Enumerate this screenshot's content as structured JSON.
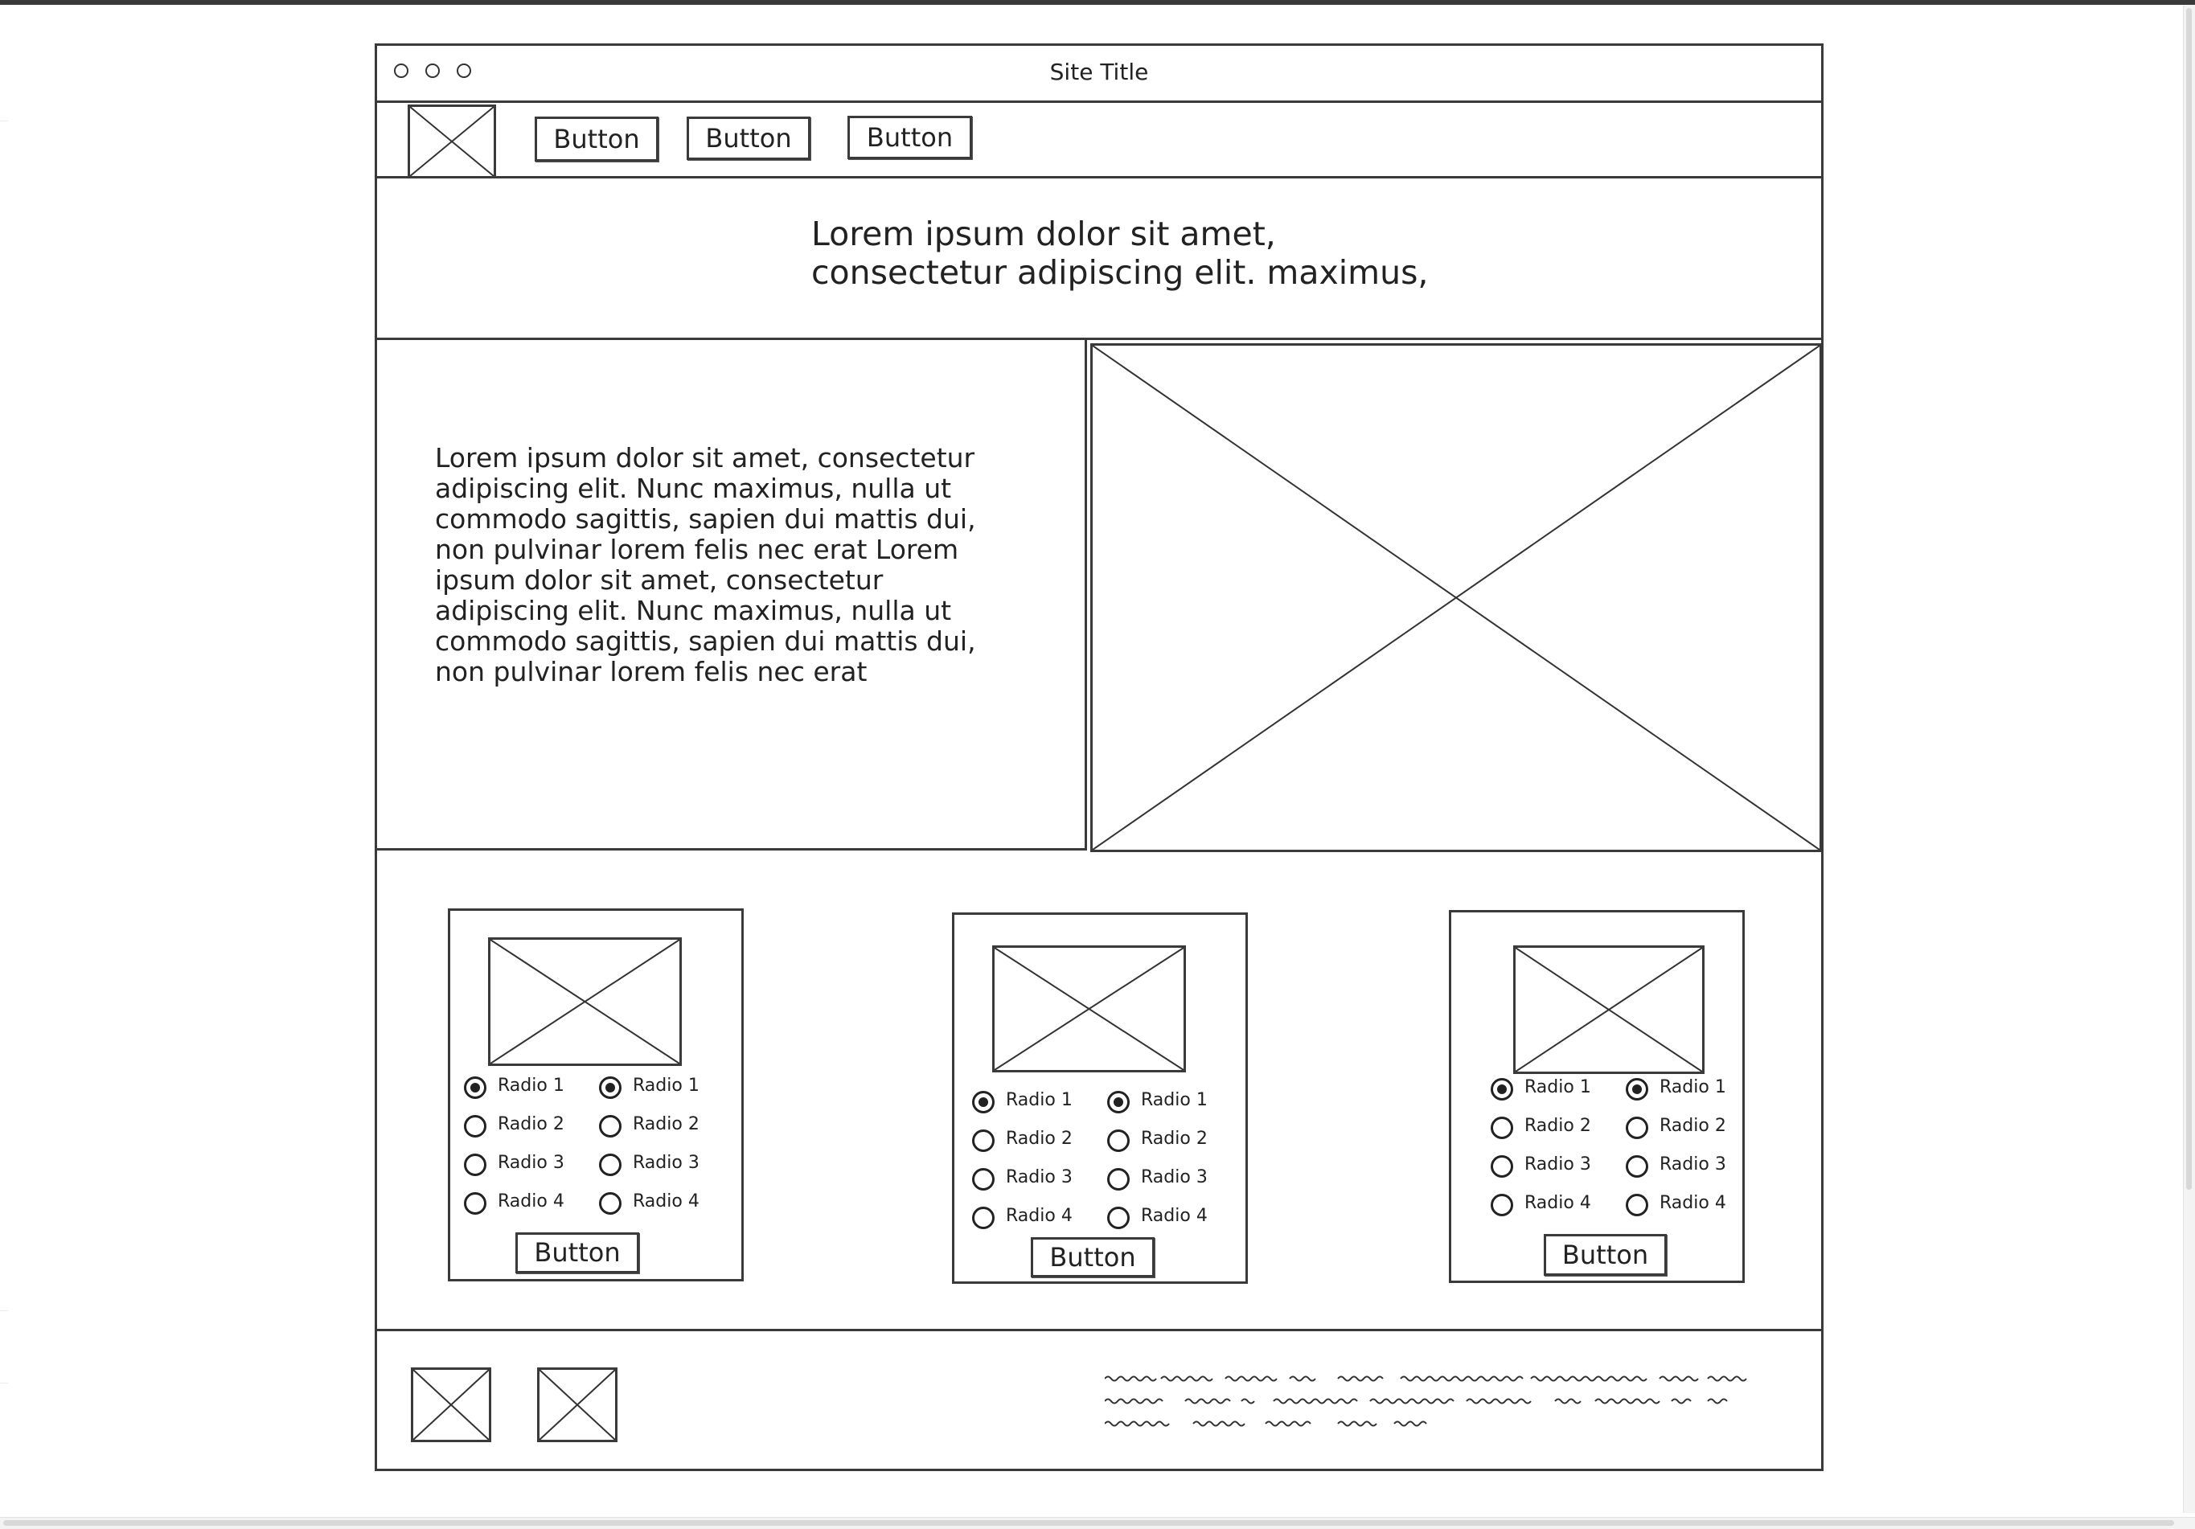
{
  "window": {
    "site_title": "Site Title"
  },
  "navbar": {
    "buttons": [
      {
        "label": "Button"
      },
      {
        "label": "Button"
      },
      {
        "label": "Button"
      }
    ]
  },
  "hero": {
    "line1": "Lorem ipsum dolor sit amet,",
    "line2": "consectetur adipiscing elit.  maximus,"
  },
  "content": {
    "lines": [
      "Lorem ipsum dolor sit amet, consectetur",
      "adipiscing elit. Nunc maximus, nulla ut",
      "commodo sagittis, sapien dui mattis dui,",
      "non pulvinar lorem felis nec erat Lorem",
      "ipsum dolor sit amet, consectetur",
      "adipiscing elit. Nunc maximus, nulla ut",
      "commodo sagittis, sapien dui mattis dui,",
      "non pulvinar lorem felis nec erat"
    ]
  },
  "cards": [
    {
      "columns": [
        {
          "radios": [
            "Radio 1",
            "Radio 2",
            "Radio 3",
            "Radio 4"
          ],
          "selected": "Radio 1"
        },
        {
          "radios": [
            "Radio 1",
            "Radio 2",
            "Radio 3",
            "Radio 4"
          ],
          "selected": "Radio 1"
        }
      ],
      "button_label": "Button"
    },
    {
      "columns": [
        {
          "radios": [
            "Radio 1",
            "Radio 2",
            "Radio 3",
            "Radio 4"
          ],
          "selected": "Radio 1"
        },
        {
          "radios": [
            "Radio 1",
            "Radio 2",
            "Radio 3",
            "Radio 4"
          ],
          "selected": "Radio 1"
        }
      ],
      "button_label": "Button"
    },
    {
      "columns": [
        {
          "radios": [
            "Radio 1",
            "Radio 2",
            "Radio 3",
            "Radio 4"
          ],
          "selected": "Radio 1"
        },
        {
          "radios": [
            "Radio 1",
            "Radio 2",
            "Radio 3",
            "Radio 4"
          ],
          "selected": "Radio 1"
        }
      ],
      "button_label": "Button"
    }
  ]
}
